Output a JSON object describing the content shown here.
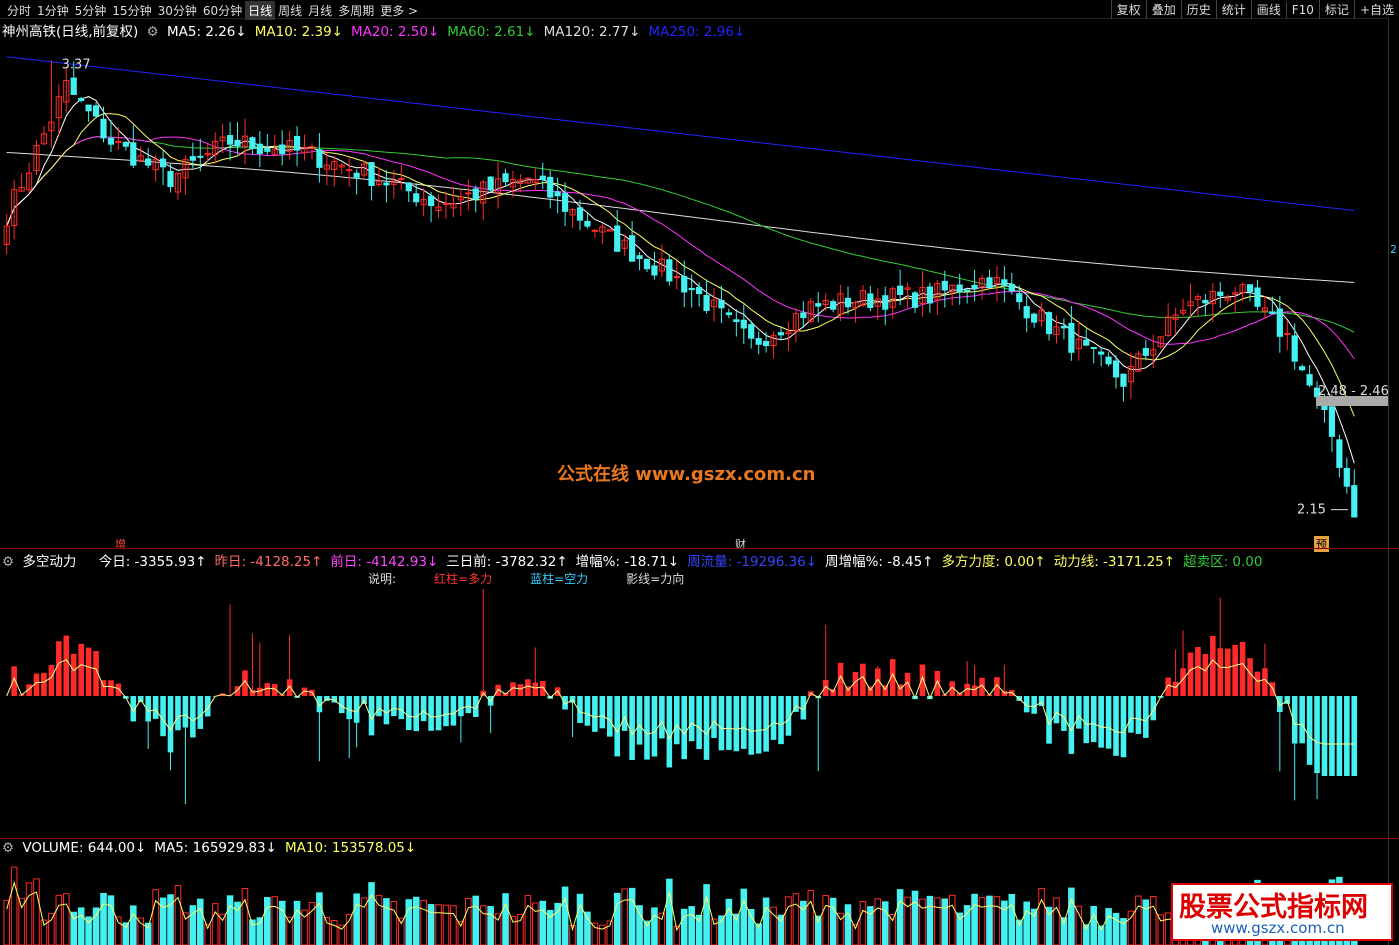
{
  "toolbar": {
    "left": [
      "分时",
      "1分钟",
      "5分钟",
      "15分钟",
      "30分钟",
      "60分钟",
      "日线",
      "周线",
      "月线",
      "多周期",
      "更多 >"
    ],
    "active": "日线",
    "right": [
      "复权",
      "叠加",
      "历史",
      "统计",
      "画线",
      "F10",
      "标记",
      "+自选"
    ]
  },
  "main": {
    "title": "神州高铁(日线,前复权)",
    "ma": [
      {
        "label": "MA5: 2.26↓",
        "color": "#ffffff"
      },
      {
        "label": "MA10: 2.39↓",
        "color": "#ffff66"
      },
      {
        "label": "MA20: 2.50↓",
        "color": "#ff33ff"
      },
      {
        "label": "MA60: 2.61↓",
        "color": "#33cc33"
      },
      {
        "label": "MA120: 2.77↓",
        "color": "#dddddd"
      },
      {
        "label": "MA250: 2.96↓",
        "color": "#2222ff"
      }
    ],
    "high_label": "3.37",
    "low_label": "2.15",
    "price_tag": "2.48 - 2.46",
    "marker_left": "增",
    "marker_mid": "财",
    "marker_right": "预",
    "watermark": "公式在线  www.gszx.com.cn",
    "scale_label": "2"
  },
  "indicator": {
    "name": "多空动力",
    "items": [
      {
        "label": "今日: -3355.93↑",
        "color": "#ffffff"
      },
      {
        "label": "昨日: -4128.25↑",
        "color": "#ff6b6b"
      },
      {
        "label": "前日: -4142.93↓",
        "color": "#ff44ff"
      },
      {
        "label": "三日前: -3782.32↑",
        "color": "#ffffff"
      },
      {
        "label": "增幅%: -18.71↓",
        "color": "#ffffff"
      },
      {
        "label": "周流量: -19296.36↓",
        "color": "#3344ff"
      },
      {
        "label": "周增幅%: -8.45↑",
        "color": "#ffffff"
      },
      {
        "label": "多方力度: 0.00↑",
        "color": "#ffff66"
      },
      {
        "label": "动力线: -3171.25↑",
        "color": "#ffff66"
      },
      {
        "label": "超卖区: 0.00",
        "color": "#33cc33"
      }
    ],
    "legend": [
      {
        "label": "说明:",
        "color": "#dddddd"
      },
      {
        "label": "红柱=多力",
        "color": "#ff3333"
      },
      {
        "label": "蓝柱=空力",
        "color": "#33ccff"
      },
      {
        "label": "影线=力向",
        "color": "#dddddd"
      }
    ]
  },
  "volume": {
    "items": [
      {
        "label": "VOLUME: 644.00↓",
        "color": "#ffffff"
      },
      {
        "label": "MA5: 165929.83↓",
        "color": "#ffffff"
      },
      {
        "label": "MA10: 153578.05↓",
        "color": "#ffff66"
      }
    ],
    "watermark_title": "股票公式指标网",
    "watermark_url": "www.gszx.com.cn"
  },
  "colors": {
    "up": "#ff2a2a",
    "down": "#44f0f0",
    "bg": "#000000",
    "ma5": "#ffffff",
    "ma10": "#ffff66",
    "ma20": "#ff33ff",
    "ma60": "#33cc33",
    "ma120": "#dddddd",
    "ma250": "#2222ff"
  }
}
